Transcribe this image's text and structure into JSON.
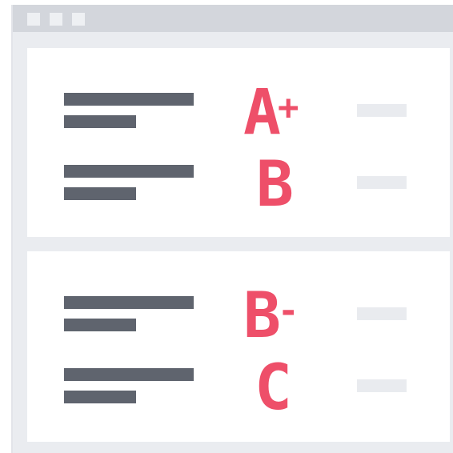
{
  "window": {
    "titlebar_dots": 3
  },
  "colors": {
    "grade": "#ee4f69",
    "text_line": "#5f646e",
    "titlebar": "#d3d6dc",
    "background": "#eaecf0",
    "card": "#ffffff"
  },
  "cards": [
    {
      "rows": [
        {
          "grade_letter": "A",
          "grade_modifier": "+"
        },
        {
          "grade_letter": "B",
          "grade_modifier": ""
        }
      ]
    },
    {
      "rows": [
        {
          "grade_letter": "B",
          "grade_modifier": "-"
        },
        {
          "grade_letter": "C",
          "grade_modifier": ""
        }
      ]
    }
  ]
}
